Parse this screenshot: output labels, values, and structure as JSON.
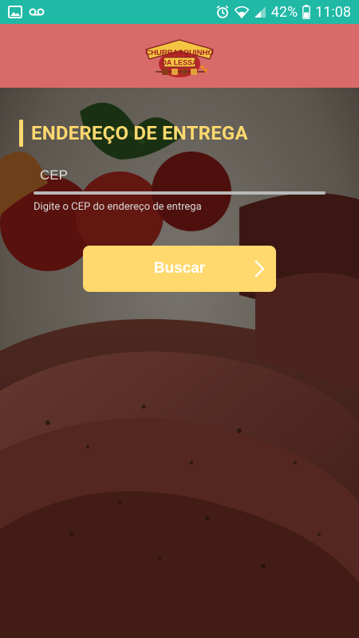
{
  "status_bar": {
    "battery_percent": "42%",
    "time": "11:08",
    "icons": [
      "gallery-icon",
      "voicemail-icon",
      "alarm-icon",
      "wifi-icon",
      "signal-icon",
      "battery-icon"
    ]
  },
  "header": {
    "logo_text_line1": "CHURRASQUINHO",
    "logo_text_line2": "DA LESSA"
  },
  "colors": {
    "status_bar": "#1fb9a6",
    "header": "#d86a6a",
    "accent": "#ffd96e"
  },
  "form": {
    "title": "ENDEREÇO DE ENTREGA",
    "cep_placeholder": "CEP",
    "cep_value": "",
    "cep_help": "Digite o CEP do endereço de entrega",
    "search_button": "Buscar"
  }
}
